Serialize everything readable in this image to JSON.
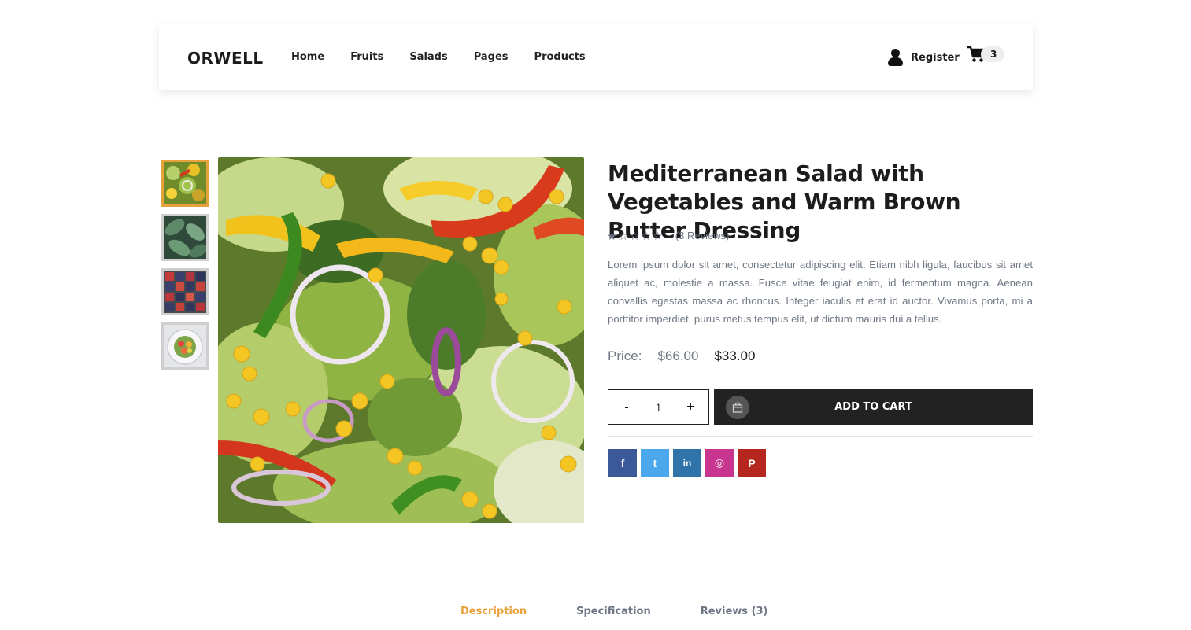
{
  "header": {
    "logo": "ORWELL",
    "nav": [
      "Home",
      "Fruits",
      "Salads",
      "Pages",
      "Products"
    ],
    "register_label": "Register",
    "cart_count": "3"
  },
  "product": {
    "title": "Mediterranean Salad with Vegetables and Warm Brown Butter Dressing",
    "rating": 1,
    "rating_max": 5,
    "reviews_label": "(3 Reviews)",
    "description": "Lorem ipsum dolor sit amet, consectetur adipiscing elit. Etiam nibh ligula, faucibus sit amet aliquet ac, molestie a massa. Fusce vitae feugiat enim, id fermentum magna. Aenean convallis egestas massa ac rhoncus. Integer iaculis et erat id auctor. Vivamus porta, mi a porttitor imperdiet, purus metus tempus elit, ut dictum mauris dui a tellus.",
    "price_label": "Price:",
    "old_price": "$66.00",
    "new_price": "$33.00",
    "quantity": "1",
    "qty_minus": "-",
    "qty_plus": "+",
    "add_to_cart_label": "ADD TO CART"
  },
  "thumbnails": [
    "salad-closeup",
    "green-leaves",
    "berry-boxes",
    "salad-bowl"
  ],
  "social": [
    {
      "name": "facebook",
      "glyph": "f",
      "color": "#3b5998"
    },
    {
      "name": "twitter",
      "glyph": "t",
      "color": "#4da7ec"
    },
    {
      "name": "linkedin",
      "glyph": "in",
      "color": "#2f73aa"
    },
    {
      "name": "instagram",
      "glyph": "◎",
      "color": "#c7358f"
    },
    {
      "name": "pinterest",
      "glyph": "P",
      "color": "#b5271e"
    }
  ],
  "tabs": [
    "Description",
    "Specification",
    "Reviews (3)"
  ],
  "colors": {
    "accent": "#e8a23b",
    "dark": "#222222",
    "muted": "#6f7885"
  }
}
